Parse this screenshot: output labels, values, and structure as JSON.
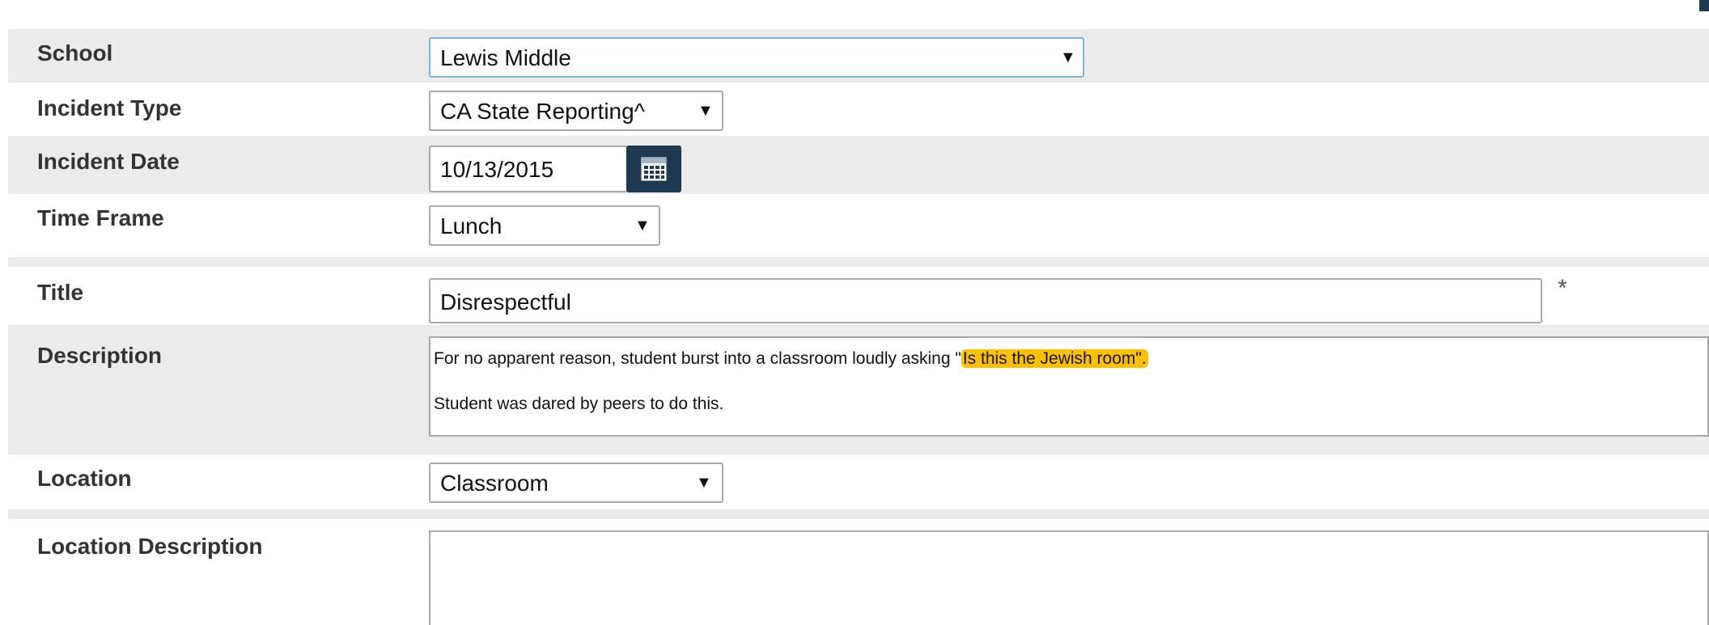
{
  "form": {
    "school": {
      "label": "School",
      "value": "Lewis Middle"
    },
    "incident_type": {
      "label": "Incident Type",
      "value": "CA State Reporting^"
    },
    "incident_date": {
      "label": "Incident Date",
      "value": "10/13/2015"
    },
    "time_frame": {
      "label": "Time Frame",
      "value": "Lunch"
    },
    "title": {
      "label": "Title",
      "value": "Disrespectful",
      "required_mark": "*"
    },
    "description": {
      "label": "Description",
      "line1_before": "For no apparent reason, student burst into a classroom loudly asking \"",
      "line1_highlight": "Is this the Jewish room\".",
      "line2": "Student was dared by peers to do this."
    },
    "location": {
      "label": "Location",
      "value": "Classroom"
    },
    "location_description": {
      "label": "Location Description",
      "value": ""
    }
  },
  "icons": {
    "dropdown": "chevron-down-icon",
    "calendar": "calendar-icon"
  },
  "colors": {
    "row_shade": "#ebebeb",
    "calendar_button": "#1d3a52",
    "highlight": "#ffc000",
    "focus_border": "#7eb4d8"
  }
}
